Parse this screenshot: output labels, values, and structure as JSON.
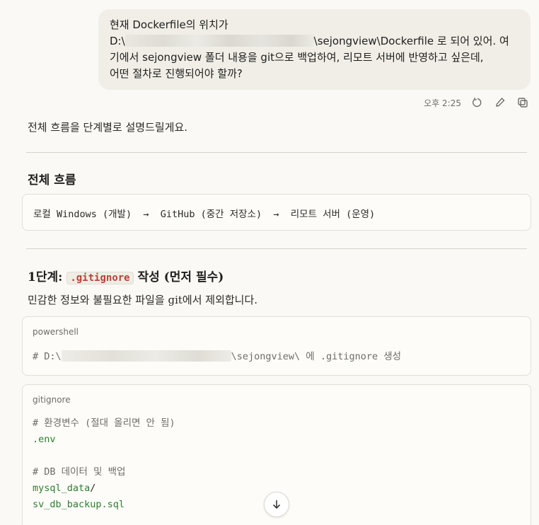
{
  "user_message": {
    "line1": "현재 Dockerfile의 위치가",
    "line2_prefix": "D:\\",
    "line2_suffix": "\\sejongview\\Dockerfile 로 되어 있어. 여",
    "line3": "기에서 sejongview 폴더 내용을 git으로 백업하여, 리모트 서버에 반영하고 싶은데,",
    "line4": "어떤 절차로 진행되어야 할까?"
  },
  "meta": {
    "time": "오후 2:25",
    "icons": [
      "retry-icon",
      "edit-icon",
      "copy-icon"
    ]
  },
  "response": {
    "intro": "전체 흐름을 단계별로 설명드릴게요.",
    "section1_title": "전체 흐름",
    "flow_text": "로컬 Windows (개발)  →  GitHub (중간 저장소)  →  리모트 서버 (운영)",
    "step1_prefix": "1단계: ",
    "step1_code": ".gitignore",
    "step1_suffix": " 작성 (먼저 필수)",
    "step1_desc": "민감한 정보와 불필요한 파일을 git에서 제외합니다.",
    "code1": {
      "lang": "powershell",
      "prefix": "# D:\\",
      "suffix": "\\sejongview\\ 에 .gitignore 생성"
    },
    "code2": {
      "lang": "gitignore",
      "line1": "# 환경변수 (절대 올리면 안 됨)",
      "line2": ".env",
      "line3": "# DB 데이터 및 백업",
      "line4_green": "mysql_data",
      "line4_slash": "/",
      "line5": "sv_db_backup.sql"
    }
  }
}
